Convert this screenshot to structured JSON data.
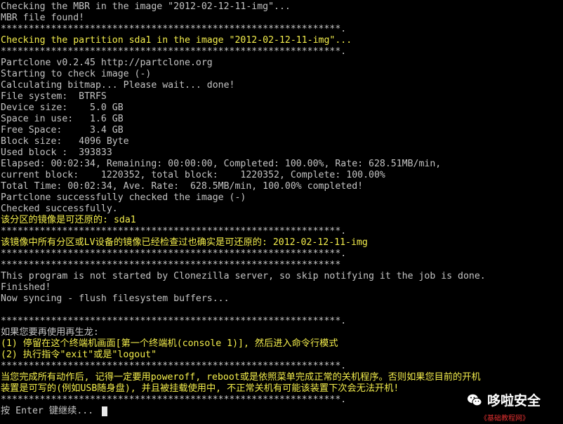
{
  "terminal": {
    "lines": [
      {
        "text": "Checking the MBR in the image \"2012-02-12-11-img\"...",
        "color": "white"
      },
      {
        "text": "MBR file found!",
        "color": "white"
      },
      {
        "text": "*************************************************************.",
        "color": "white"
      },
      {
        "text": "Checking the partition sda1 in the image \"2012-02-12-11-img\"...",
        "color": "yellow"
      },
      {
        "text": "*************************************************************.",
        "color": "white"
      },
      {
        "text": "Partclone v0.2.45 http://partclone.org",
        "color": "white"
      },
      {
        "text": "Starting to check image (-)",
        "color": "white"
      },
      {
        "text": "Calculating bitmap... Please wait... done!",
        "color": "white"
      },
      {
        "text": "File system:  BTRFS",
        "color": "white"
      },
      {
        "text": "Device size:    5.0 GB",
        "color": "white"
      },
      {
        "text": "Space in use:   1.6 GB",
        "color": "white"
      },
      {
        "text": "Free Space:     3.4 GB",
        "color": "white"
      },
      {
        "text": "Block size:   4096 Byte",
        "color": "white"
      },
      {
        "text": "Used block :  393833",
        "color": "white"
      },
      {
        "text": "Elapsed: 00:02:34, Remaining: 00:00:00, Completed: 100.00%, Rate: 628.51MB/min,",
        "color": "white"
      },
      {
        "text": "current block:    1220352, total block:    1220352, Complete: 100.00%",
        "color": "white"
      },
      {
        "text": "Total Time: 00:02:34, Ave. Rate:  628.5MB/min, 100.00% completed!",
        "color": "white"
      },
      {
        "text": "Partclone successfully checked the image (-)",
        "color": "white"
      },
      {
        "text": "Checked successfully.",
        "color": "white"
      },
      {
        "text": "该分区的镜像是可还原的: sda1",
        "color": "yellow"
      },
      {
        "text": "*************************************************************.",
        "color": "white"
      },
      {
        "text": "该镜像中所有分区或LV设备的镜像已经检查过也确实是可还原的: 2012-02-12-11-img",
        "color": "yellow"
      },
      {
        "text": "*************************************************************.",
        "color": "white"
      },
      {
        "text": "*************************************************************",
        "color": "white"
      },
      {
        "text": "This program is not started by Clonezilla server, so skip notifying it the job is done.",
        "color": "white"
      },
      {
        "text": "Finished!",
        "color": "white"
      },
      {
        "text": "Now syncing - flush filesystem buffers...",
        "color": "white"
      },
      {
        "text": "",
        "color": "white"
      },
      {
        "text": "*************************************************************.",
        "color": "white"
      },
      {
        "text": "如果您要再使用再生龙:",
        "color": "white"
      },
      {
        "text": "(1) 停留在这个终端机画面[第一个终端机(console 1)], 然后进入命令行模式",
        "color": "yellow"
      },
      {
        "text": "(2) 执行指令\"exit\"或是\"logout\"",
        "color": "yellow"
      },
      {
        "text": "*************************************************************.",
        "color": "white"
      },
      {
        "text": "当您完成所有动作后, 记得一定要用poweroff, reboot或是依照菜单完成正常的关机程序。否则如果您目前的开机",
        "color": "yellow"
      },
      {
        "text": "装置是可写的(例如USB随身盘), 并且被挂载使用中, 不正常关机有可能该装置下次会无法开机!",
        "color": "yellow"
      },
      {
        "text": "*************************************************************.",
        "color": "white"
      },
      {
        "text": "按 Enter 键继续...",
        "color": "white"
      }
    ]
  },
  "watermark": {
    "brand": "哆啦安全",
    "subtitle": "《基础教程网》",
    "icon": "wechat-icon"
  },
  "colors": {
    "background": "#000000",
    "text_white": "#c4c4c4",
    "text_yellow": "#f4ee4c",
    "watermark_red": "#e03030"
  }
}
